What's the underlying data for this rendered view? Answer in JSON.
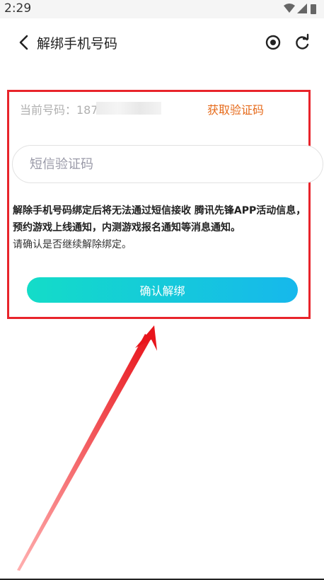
{
  "status_bar": {
    "time": "2:29"
  },
  "nav": {
    "title": "解绑手机号码"
  },
  "form": {
    "phone_label": "当前号码：187",
    "get_code_label": "获取验证码",
    "code_placeholder": "短信验证码",
    "notice_bold": "解除手机号码绑定后将无法通过短信接收 腾讯先锋APP活动信息，预约游戏上线通知，内测游戏报名通知等消息通知。",
    "notice_normal": "请确认是否继续解除绑定。",
    "confirm_label": "确认解绑"
  },
  "colors": {
    "highlight": "#e8242b",
    "get_code": "#e66a1a",
    "button_gradient_start": "#14dcc8",
    "button_gradient_end": "#16b8ec"
  }
}
